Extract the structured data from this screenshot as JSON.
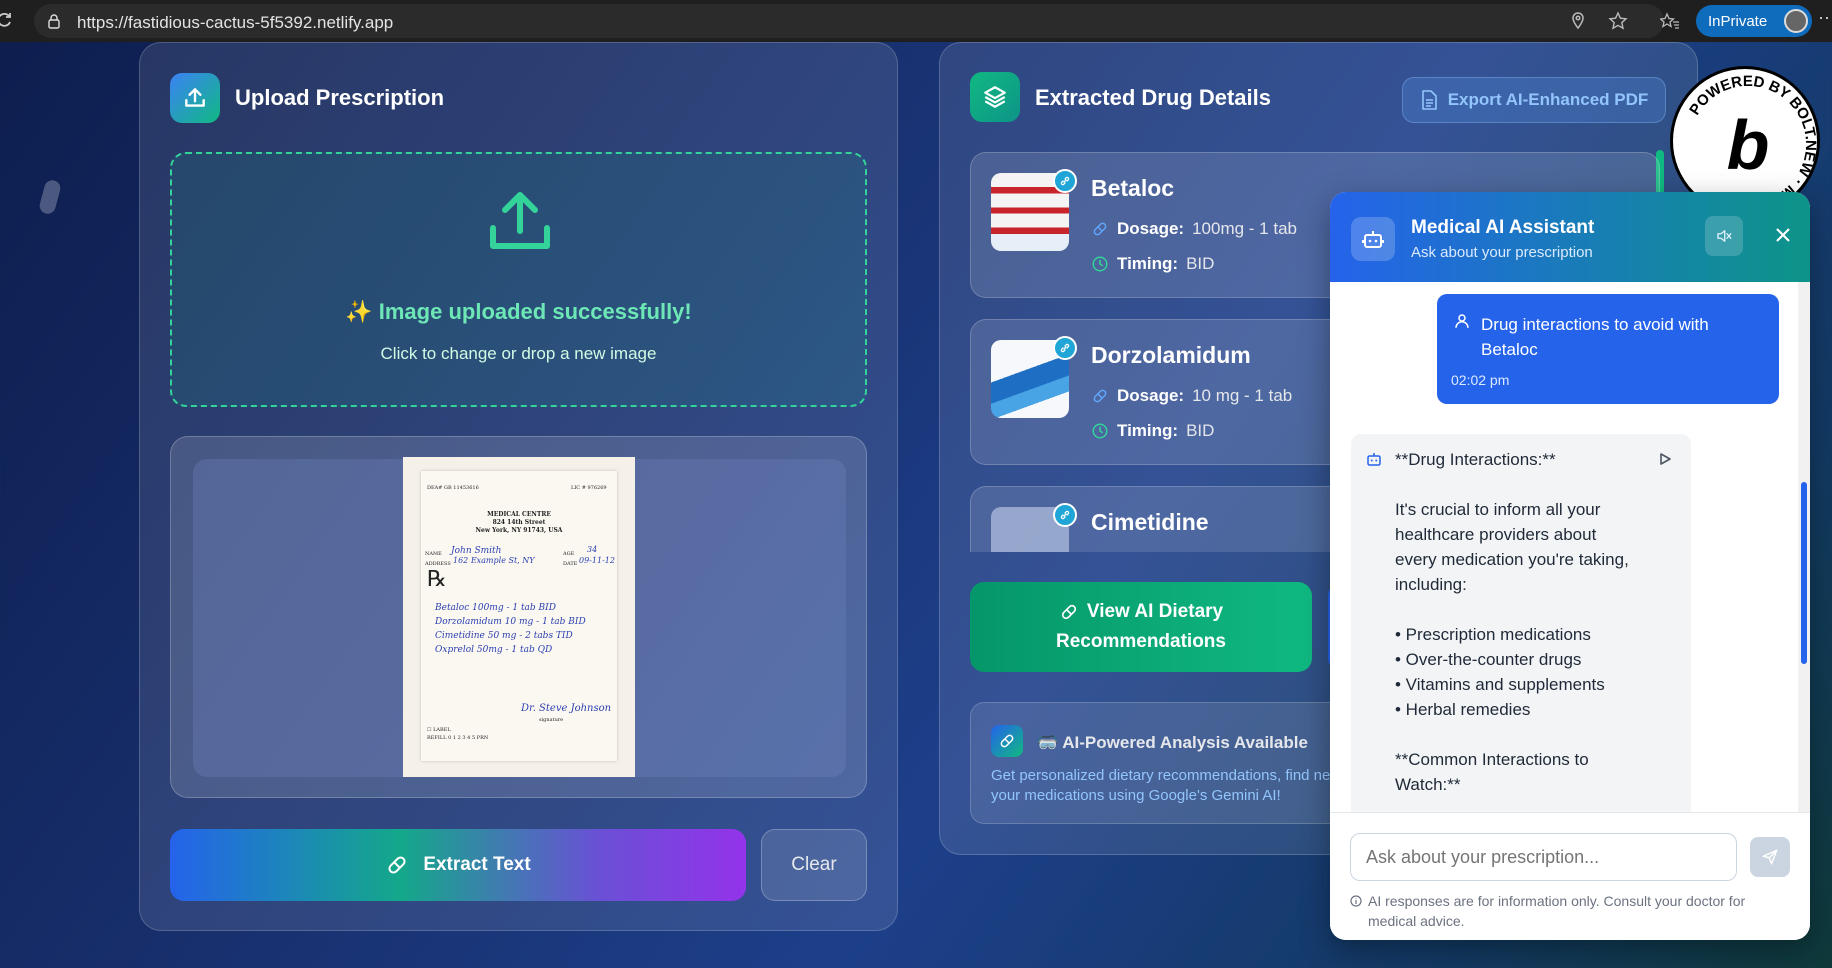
{
  "browser": {
    "url": "https://fastidious-cactus-5f5392.netlify.app",
    "inprivate_label": "InPrivate"
  },
  "upload": {
    "title": "Upload Prescription",
    "success_text": "✨ Image uploaded successfully!",
    "sub_text": "Click to change or drop a new image",
    "extract_label": "Extract Text",
    "clear_label": "Clear"
  },
  "prescription": {
    "dea": "DEA# GB 11453616",
    "lic": "LIC # 976269",
    "clinic_name": "MEDICAL CENTRE",
    "clinic_street": "824 14th Street",
    "clinic_city": "New York, NY 91743, USA",
    "name_label": "NAME",
    "name_value": "John Smith",
    "age_label": "AGE",
    "age_value": "34",
    "address_label": "ADDRESS",
    "address_value": "162 Example St, NY",
    "date_label": "DATE",
    "date_value": "09-11-12",
    "rx_symbol": "℞",
    "lines": [
      "Betaloc 100mg - 1 tab BID",
      "Dorzolamidum 10 mg - 1 tab BID",
      "Cimetidine 50 mg - 2 tabs TID",
      "Oxprelol 50mg - 1 tab QD"
    ],
    "signature": "Dr. Steve Johnson",
    "signature_label": "signature",
    "label_text": "☐ LABEL",
    "refill_text": "REFILL 0 1 2 3 4 5 PRN"
  },
  "extracted": {
    "title": "Extracted Drug Details",
    "export_label": "Export AI-Enhanced PDF",
    "dosage_label": "Dosage:",
    "timing_label": "Timing:",
    "drugs": [
      {
        "name": "Betaloc",
        "dosage": "100mg - 1 tab",
        "timing": "BID"
      },
      {
        "name": "Dorzolamidum",
        "dosage": "10 mg - 1 tab",
        "timing": "BID"
      },
      {
        "name": "Cimetidine"
      }
    ],
    "diet_button_line1": "View AI Dietary",
    "diet_button_line2": "Recommendations",
    "ai_title": "🥽 AI-Powered Analysis Available",
    "ai_desc_1": "Get personalized dietary recommendations, find ne",
    "ai_desc_2": "your medications using Google's Gemini AI!"
  },
  "chat": {
    "title": "Medical AI Assistant",
    "subtitle": "Ask about your prescription",
    "user_message_1": "Drug interactions to avoid with",
    "user_message_2": "Betaloc",
    "user_time": "02:02 pm",
    "bot_lines": [
      "**Drug Interactions:**",
      "It's crucial to inform all your",
      "healthcare providers about",
      "every medication you're taking,",
      "including:",
      "• Prescription medications",
      "• Over-the-counter drugs",
      "• Vitamins and supplements",
      "• Herbal remedies",
      "**Common Interactions to",
      "Watch:**"
    ],
    "input_placeholder": "Ask about your prescription...",
    "disclaimer": "AI responses are for information only. Consult your doctor for medical advice."
  },
  "badge": {
    "ring_text": "POWERED BY BOLT.NEW · MADE IN ",
    "letter": "b"
  },
  "colors": {
    "accent_green": "#10b981",
    "accent_blue": "#2563eb",
    "success_text": "#6ee7b7"
  }
}
